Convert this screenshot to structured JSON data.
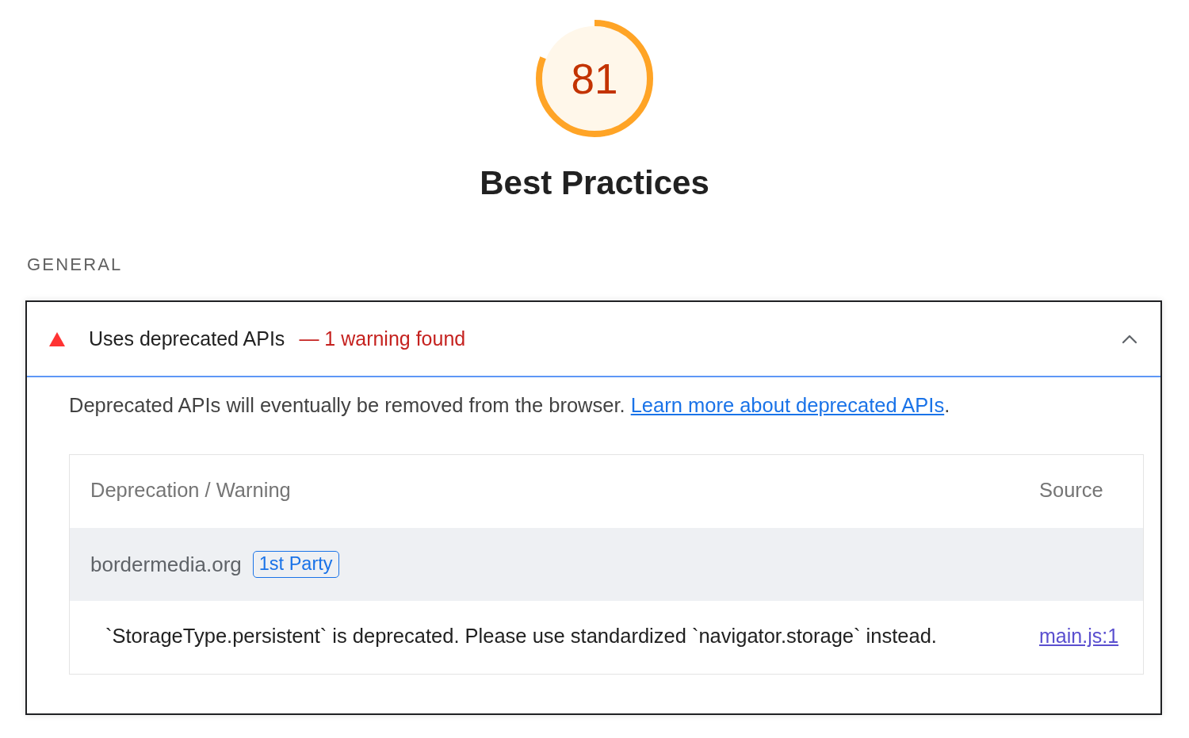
{
  "gauge": {
    "score": "81",
    "level": 0.81
  },
  "category_title": "Best Practices",
  "group_title": "GENERAL",
  "audit": {
    "title": "Uses deprecated APIs",
    "summary": "— 1 warning found",
    "expanded": true,
    "description": {
      "text": "Deprecated APIs will eventually be removed from the browser.",
      "link": {
        "label": "Learn more about deprecated APIs",
        "visited": false
      },
      "trailing": "."
    },
    "table": {
      "columns": [
        "Deprecation / Warning",
        "Source"
      ],
      "groups": [
        {
          "entity": "bordermedia.org",
          "badge": "1st Party",
          "rows": [
            {
              "message": "`StorageType.persistent` is deprecated. Please use standardized `navigator.storage` instead.",
              "source": {
                "label": "main.js:1",
                "visited": true
              }
            }
          ]
        }
      ]
    }
  }
}
